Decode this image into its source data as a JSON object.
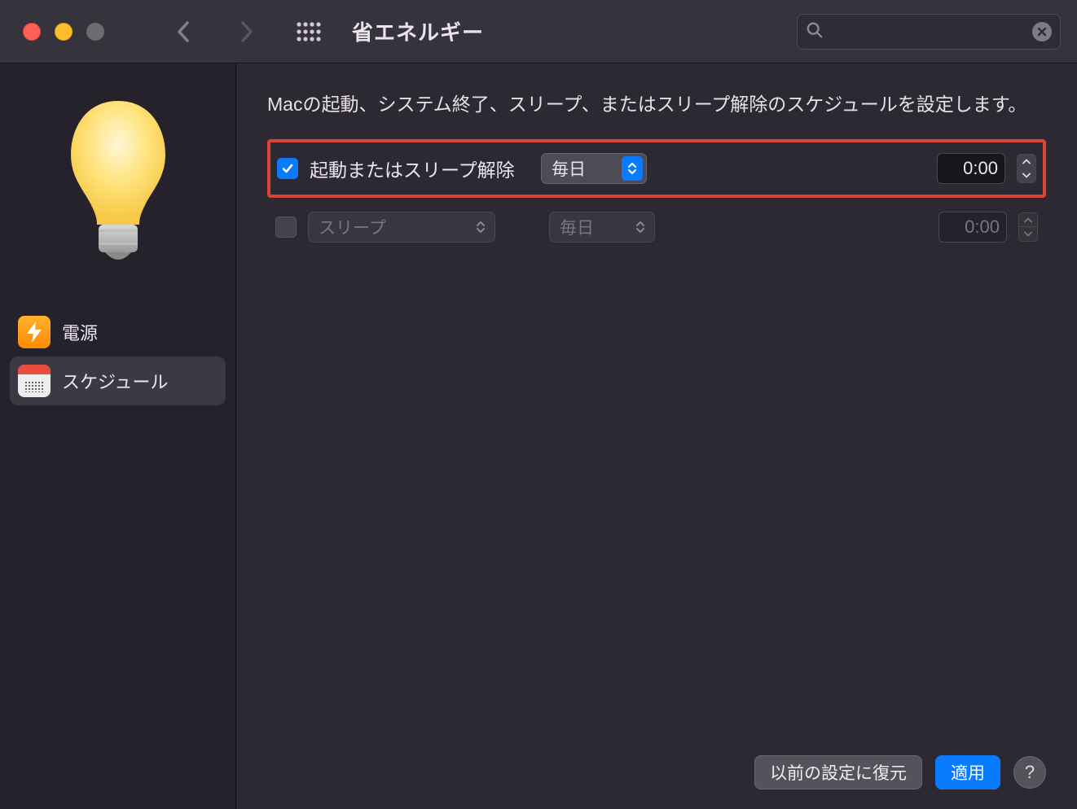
{
  "window": {
    "title": "省エネルギー",
    "search_placeholder": ""
  },
  "sidebar": {
    "items": [
      {
        "icon": "bolt-icon",
        "label": "電源"
      },
      {
        "icon": "calendar-icon",
        "label": "スケジュール"
      }
    ],
    "selected_index": 1
  },
  "main": {
    "description": "Macの起動、システム終了、スリープ、またはスリープ解除のスケジュールを設定します。",
    "rows": [
      {
        "checked": true,
        "label": "起動またはスリープ解除",
        "frequency": "毎日",
        "time": "0:00",
        "enabled": true,
        "highlighted": true
      },
      {
        "checked": false,
        "action_label": "スリープ",
        "frequency": "毎日",
        "time": "0:00",
        "enabled": false,
        "highlighted": false
      }
    ]
  },
  "footer": {
    "restore_label": "以前の設定に復元",
    "apply_label": "適用",
    "help_label": "?"
  }
}
